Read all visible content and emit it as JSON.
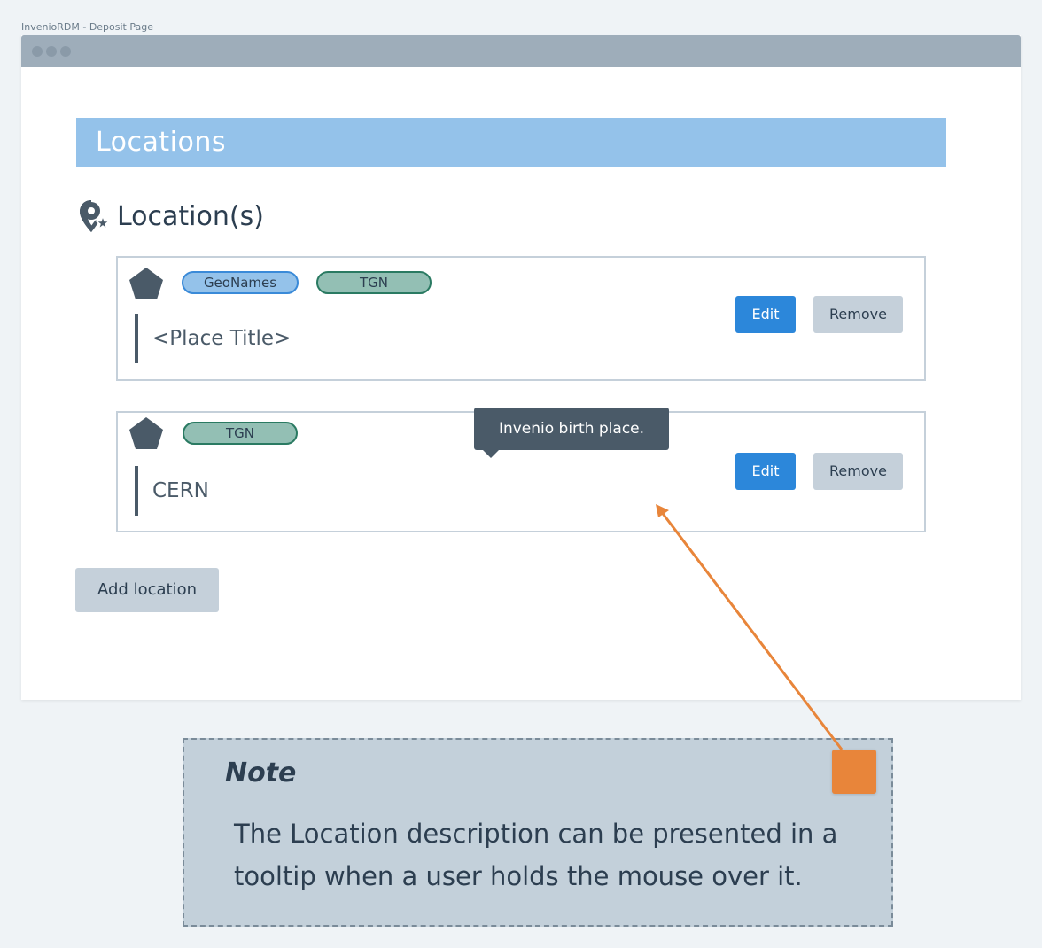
{
  "page_label": "InvenioRDM - Deposit Page",
  "section": {
    "title": "Locations"
  },
  "field": {
    "title": "Location(s)",
    "icon": "map-pin-star-icon"
  },
  "locations": [
    {
      "icon": "pentagon-icon",
      "badges": [
        "GeoNames",
        "TGN"
      ],
      "place": "<Place Title>",
      "edit_label": "Edit",
      "remove_label": "Remove"
    },
    {
      "icon": "pentagon-icon",
      "badges": [
        "TGN"
      ],
      "place": "CERN",
      "edit_label": "Edit",
      "remove_label": "Remove"
    }
  ],
  "tooltip": {
    "text": "Invenio birth place."
  },
  "add_button": {
    "label": "Add location"
  },
  "note": {
    "title": "Note",
    "body": "The Location description can be presented in a tooltip when a user holds the mouse over it.",
    "marker_color": "#e8853a"
  },
  "colors": {
    "section_header": "#94c2ea",
    "primary": "#2c87da",
    "secondary": "#c5d0da",
    "dark": "#4a5a68",
    "geonames_badge": "#94c2ea",
    "tgn_badge": "#93bfb4"
  }
}
